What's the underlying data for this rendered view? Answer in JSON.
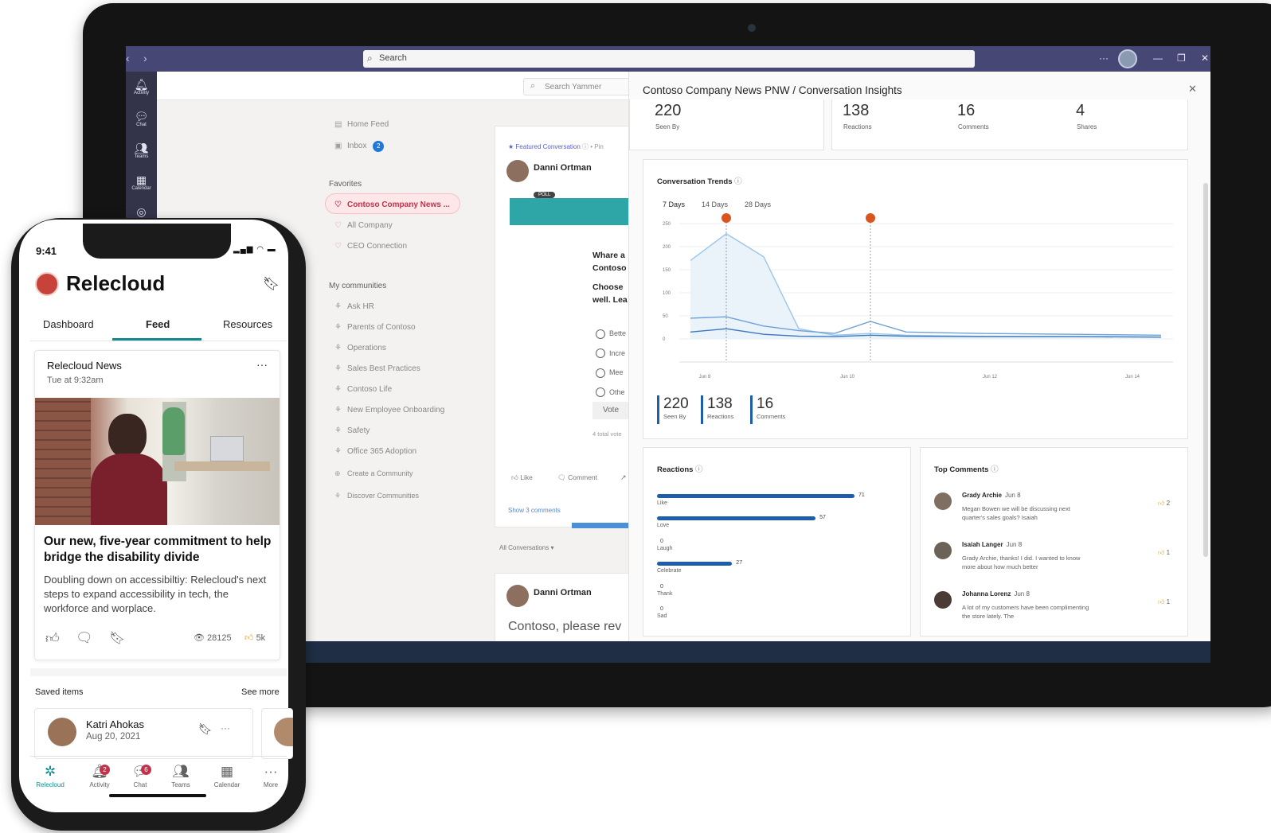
{
  "teams": {
    "search_placeholder": "Search",
    "rail": [
      "Activity",
      "Chat",
      "Teams",
      "Calendar"
    ]
  },
  "yammer": {
    "search_placeholder": "Search Yammer",
    "home_feed": "Home Feed",
    "inbox": "Inbox",
    "inbox_count": "2",
    "favorites_heading": "Favorites",
    "favorites": [
      "Contoso Company News ...",
      "All Company",
      "CEO Connection"
    ],
    "communities_heading": "My communities",
    "communities": [
      "Ask HR",
      "Parents of Contoso",
      "Operations",
      "Sales Best Practices",
      "Contoso Life",
      "New Employee Onboarding",
      "Safety",
      "Office 365 Adoption"
    ],
    "create_community": "Create a Community",
    "discover_communities": "Discover Communities",
    "post": {
      "featured": "Featured Conversation",
      "featured_tail": "Pin",
      "author": "Danni Ortman",
      "poll_badge": "POLL",
      "question": [
        "Whare a",
        "Contoso",
        "Choose",
        "well. Lea"
      ],
      "options": [
        "Bette",
        "Incre",
        "Mee",
        "Othe"
      ],
      "vote": "Vote",
      "total_votes": "4 total vote",
      "like": "Like",
      "comment": "Comment",
      "show_comments": "Show 3 comments"
    },
    "all_conversations": "All Conversations",
    "post2": {
      "author": "Danni Ortman",
      "body": "Contoso, please rev"
    }
  },
  "insights": {
    "title": "Contoso Company News PNW / Conversation Insights",
    "top_stats": [
      {
        "value": "220",
        "label": "Seen By"
      },
      {
        "value": "138",
        "label": "Reactions"
      },
      {
        "value": "16",
        "label": "Comments"
      },
      {
        "value": "4",
        "label": "Shares"
      }
    ],
    "trends_title": "Conversation Trends",
    "ranges": [
      "7 Days",
      "14 Days",
      "28 Days"
    ],
    "bottom_stats": [
      {
        "value": "220",
        "label": "Seen By"
      },
      {
        "value": "138",
        "label": "Reactions"
      },
      {
        "value": "16",
        "label": "Comments"
      }
    ],
    "reactions_title": "Reactions",
    "reactions": [
      {
        "label": "Like",
        "value": 71
      },
      {
        "label": "Love",
        "value": 57
      },
      {
        "label": "Laugh",
        "value": 0
      },
      {
        "label": "Celebrate",
        "value": 27
      },
      {
        "label": "Thank",
        "value": 0
      },
      {
        "label": "Sad",
        "value": 0
      }
    ],
    "comments_title": "Top Comments",
    "comments": [
      {
        "name": "Grady Archie",
        "date": "Jun 8",
        "text": "Megan Bowen we will be discussing next quarter's sales goals? Isaiah",
        "likes": "2"
      },
      {
        "name": "Isaiah Langer",
        "date": "Jun 8",
        "text": "Grady Archie, thanks! I did. I wanted to know more about how much better",
        "likes": "1"
      },
      {
        "name": "Johanna Lorenz",
        "date": "Jun 8",
        "text": "A lot of my customers have been complimenting the store lately. The",
        "likes": "1"
      }
    ]
  },
  "chart_data": {
    "type": "area",
    "title": "Conversation Trends",
    "x_ticks": [
      "Jun 8",
      "Jun 10",
      "Jun 12",
      "Jun 14"
    ],
    "y_ticks": [
      250,
      200,
      150,
      100,
      50,
      0
    ],
    "ylim": [
      0,
      250
    ],
    "x": [
      "Jun 7",
      "Jun 8",
      "Jun 9",
      "Jun 9",
      "Jun 10",
      "Jun 10",
      "Jun 11",
      "Jun 12",
      "Jun 13",
      "Jun 14"
    ],
    "series": [
      {
        "values": [
          170,
          228,
          178,
          22,
          8,
          12,
          8,
          6,
          5,
          4
        ]
      },
      {
        "values": [
          45,
          48,
          28,
          18,
          12,
          38,
          15,
          12,
          10,
          8
        ]
      },
      {
        "values": [
          15,
          22,
          10,
          6,
          5,
          8,
          6,
          5,
          5,
          4
        ]
      }
    ],
    "grid": true
  },
  "phone": {
    "time": "9:41",
    "app_title": "Relecloud",
    "tabs": [
      "Dashboard",
      "Feed",
      "Resources"
    ],
    "card": {
      "source": "Relecloud News",
      "time": "Tue at 9:32am",
      "headline": "Our new, five-year commitment to help bridge the disability divide",
      "body": "Doubling down on accessibiltiy: Relecloud's next steps to expand accessibility in tech, the workforce and worplace.",
      "views": "28125",
      "likes": "5k"
    },
    "saved_heading": "Saved items",
    "see_more": "See more",
    "saved_item": {
      "name": "Katri Ahokas",
      "date": "Aug 20, 2021"
    },
    "nav": [
      {
        "label": "Relecloud",
        "badge": ""
      },
      {
        "label": "Activity",
        "badge": "2"
      },
      {
        "label": "Chat",
        "badge": "6"
      },
      {
        "label": "Teams",
        "badge": ""
      },
      {
        "label": "Calendar",
        "badge": ""
      },
      {
        "label": "More",
        "badge": ""
      }
    ],
    "accent": "#0f8b8d"
  }
}
